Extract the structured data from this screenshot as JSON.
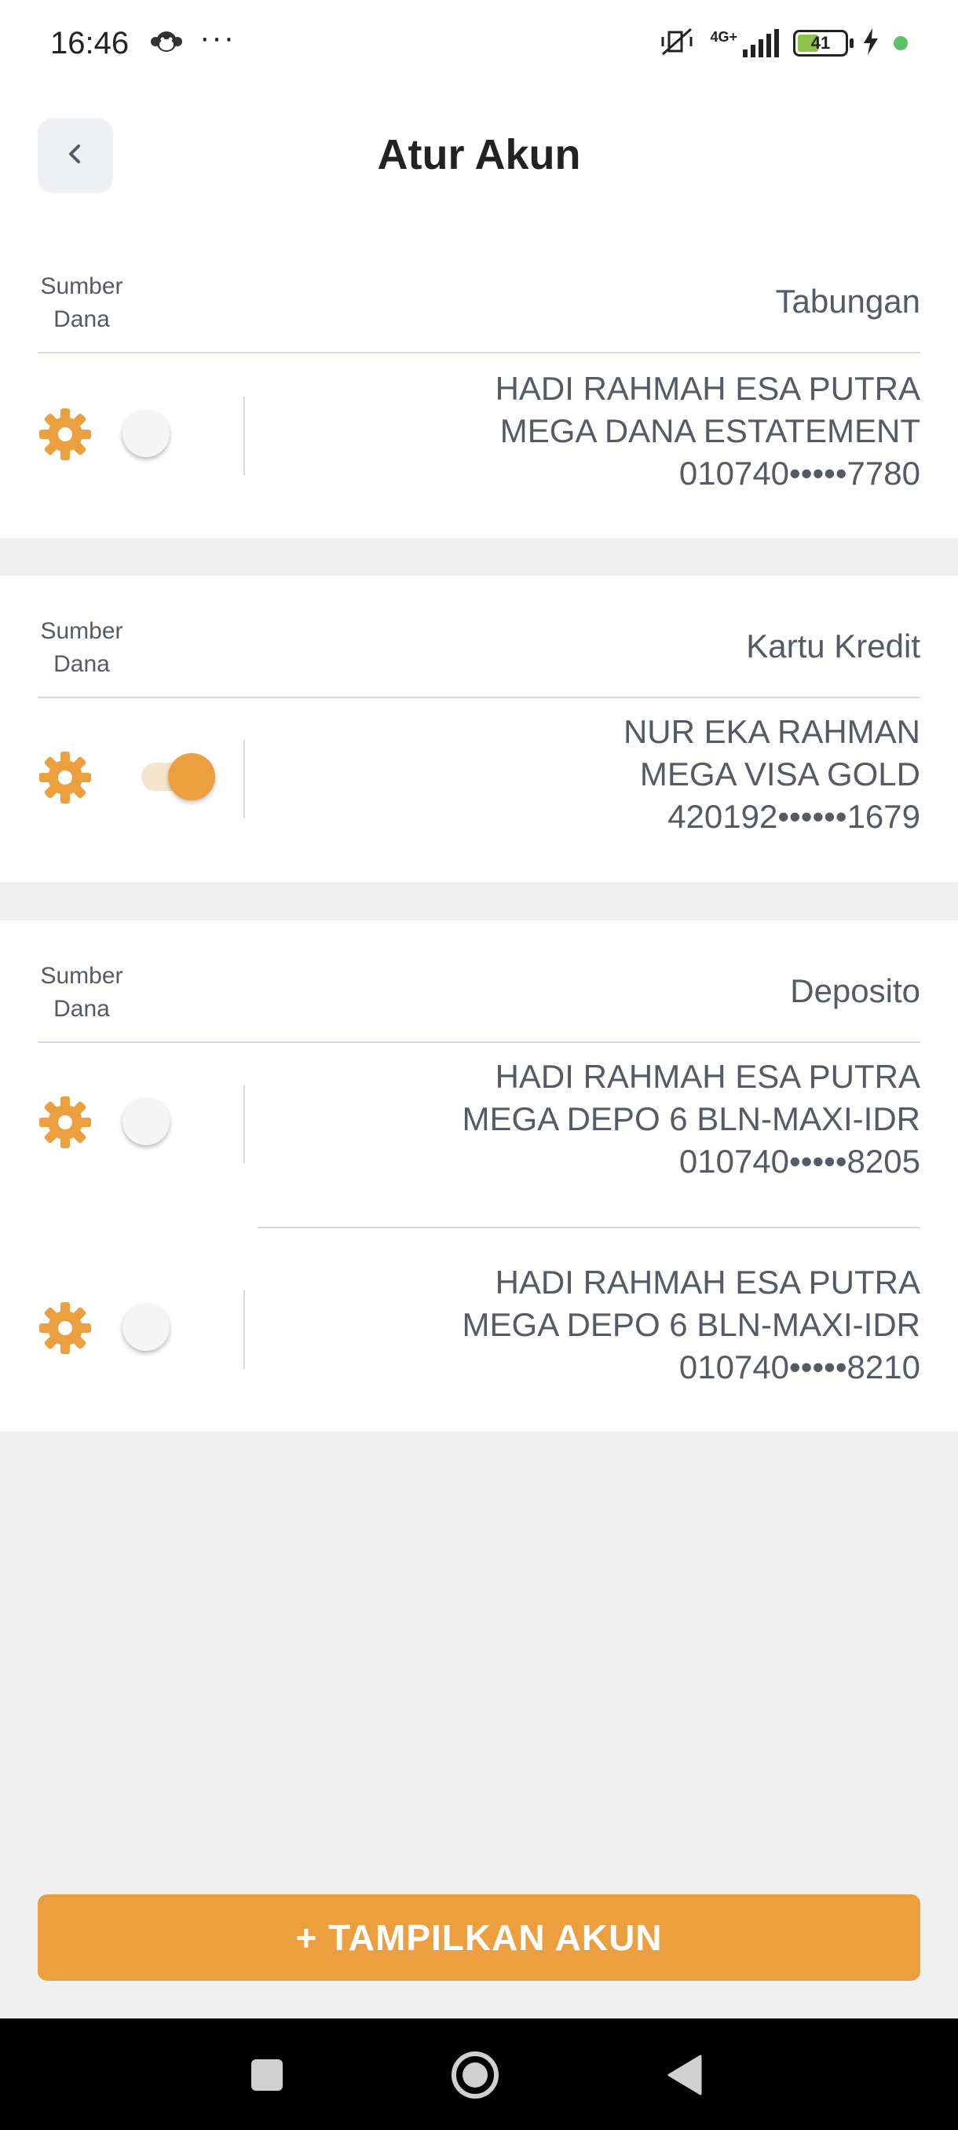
{
  "status_bar": {
    "time": "16:46",
    "more_dots": "···",
    "network": "4G+",
    "battery": "41",
    "icons": [
      "monkey-icon",
      "mute-icon",
      "signal-icon",
      "battery-icon",
      "charging-icon"
    ]
  },
  "header": {
    "title": "Atur Akun",
    "back_icon": "chevron-left-icon"
  },
  "sections": [
    {
      "label": "Sumber\nDana",
      "label_lines": [
        "Sumber",
        "Dana"
      ],
      "type": "Tabungan",
      "accounts": [
        {
          "name": "HADI RAHMAH ESA PUTRA",
          "product": "MEGA DANA ESTATEMENT",
          "number": "010740•••••7780",
          "enabled": false
        }
      ]
    },
    {
      "label_lines": [
        "Sumber",
        "Dana"
      ],
      "type": "Kartu Kredit",
      "accounts": [
        {
          "name": "NUR EKA RAHMAN",
          "product": "MEGA VISA GOLD",
          "number": "420192••••••1679",
          "enabled": true
        }
      ]
    },
    {
      "label_lines": [
        "Sumber",
        "Dana"
      ],
      "type": "Deposito",
      "accounts": [
        {
          "name": "HADI RAHMAH ESA PUTRA",
          "product": "MEGA DEPO 6 BLN-MAXI-IDR",
          "number": "010740•••••8205",
          "enabled": false
        },
        {
          "name": "HADI RAHMAH ESA PUTRA",
          "product": "MEGA DEPO 6 BLN-MAXI-IDR",
          "number": "010740•••••8210",
          "enabled": false
        }
      ]
    }
  ],
  "footer": {
    "show_account_button": "+ TAMPILKAN AKUN"
  },
  "navbar": {
    "items": [
      "recents-square-icon",
      "home-circle-icon",
      "back-triangle-icon"
    ]
  },
  "colors": {
    "accent": "#eb9f3e",
    "toggle_track_on": "#f6e4cd",
    "text": "#555a66",
    "divider": "#d6d8e6",
    "background": "#f0f0f0"
  }
}
